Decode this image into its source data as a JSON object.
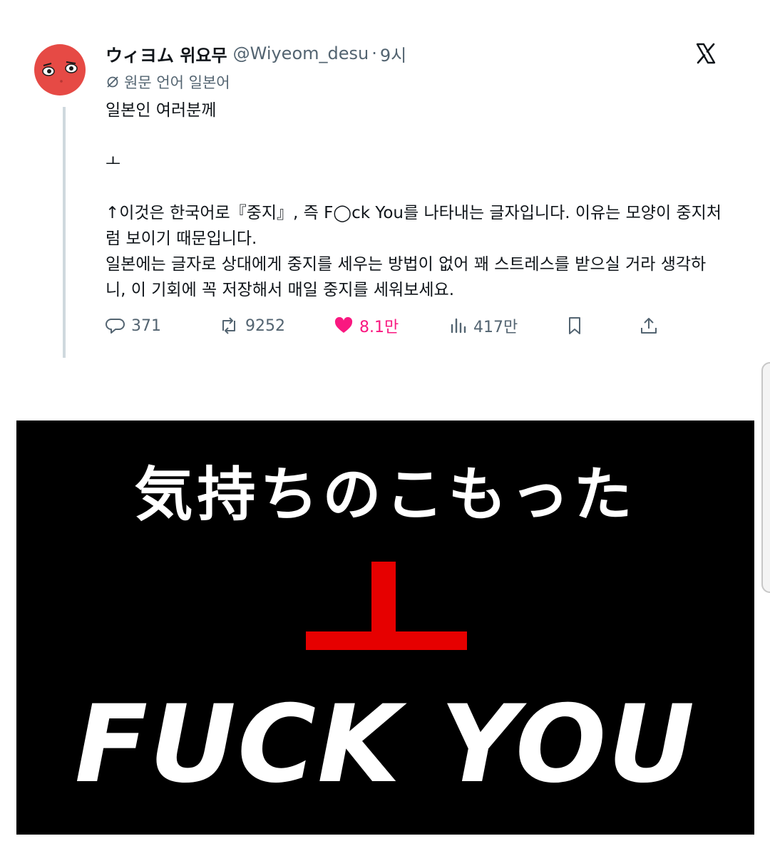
{
  "tweet": {
    "display_name": "ウィヨム 위요무",
    "handle": "@Wiyeom_desu",
    "separator": "·",
    "time": "9시",
    "translation_note": "원문 언어 일본어",
    "paragraphs": [
      "일본인 여러분께",
      "",
      "ㅗ",
      "",
      "↑이것은 한국어로『중지』, 즉 F◯ck You를 나타내는 글자입니다. 이유는 모양이 중지처럼 보이기 때문입니다.",
      "일본에는 글자로 상대에게 중지를 세우는 방법이 없어 꽤 스트레스를 받으실 거라 생각하니, 이 기회에 꼭 저장해서 매일 중지를 세워보세요."
    ],
    "stats": {
      "replies": "371",
      "reposts": "9252",
      "likes": "8.1만",
      "views": "417만"
    }
  },
  "media": {
    "caption": "気持ちのこもった",
    "big_text": "FUCK YOU"
  },
  "colors": {
    "avatar": "#e64a45",
    "like": "#f91880",
    "muted": "#536471",
    "glyph_red": "#e60000"
  },
  "icons": [
    "x-logo-icon",
    "translate-icon",
    "reply-icon",
    "repost-icon",
    "heart-icon",
    "views-icon",
    "bookmark-icon",
    "share-icon"
  ]
}
